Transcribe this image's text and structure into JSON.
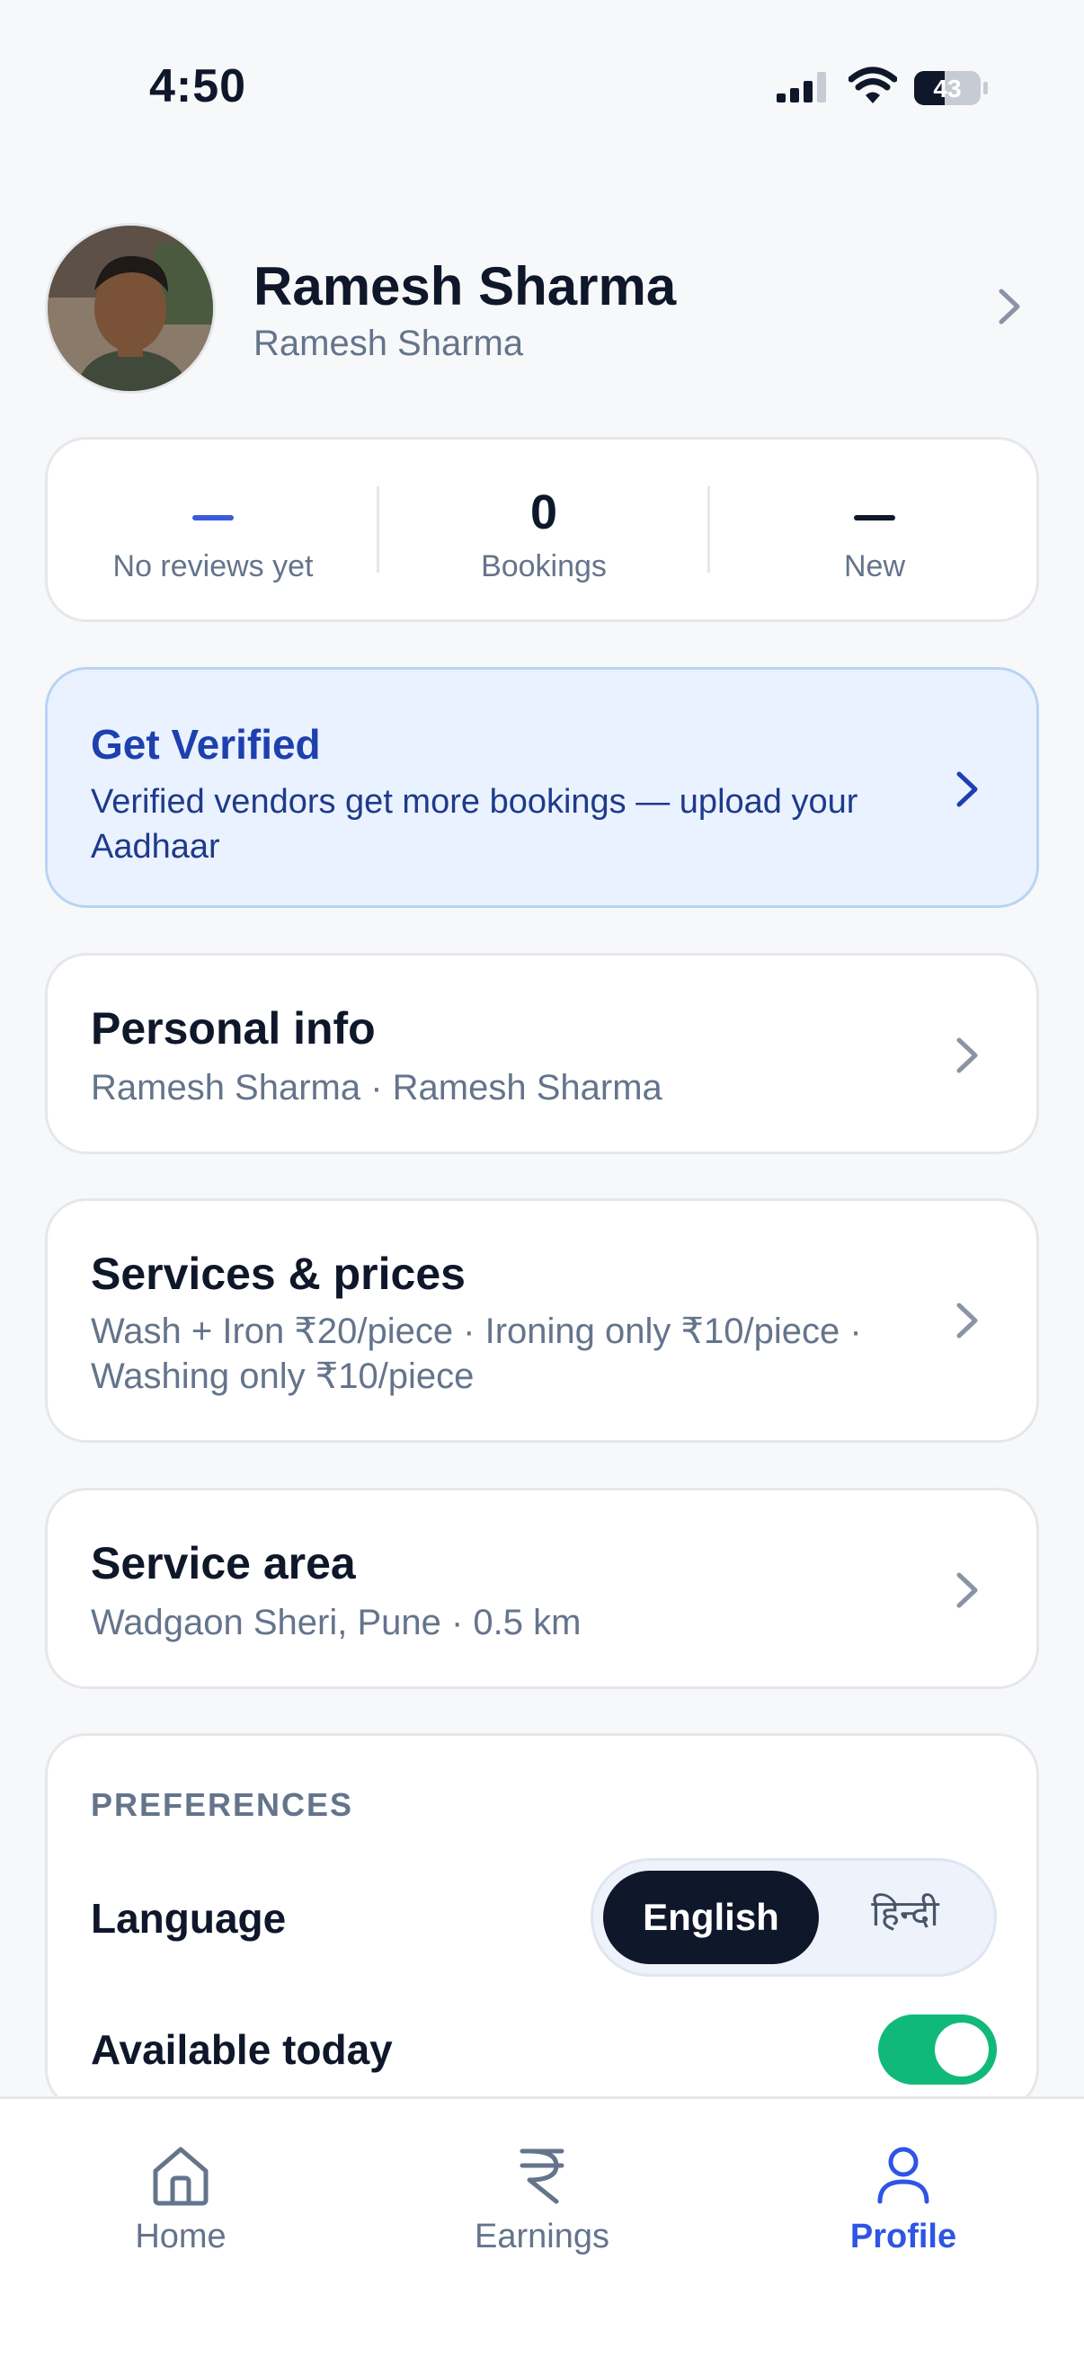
{
  "status_bar": {
    "time": "4:50",
    "battery": "43"
  },
  "profile": {
    "name": "Ramesh Sharma",
    "subtitle": "Ramesh Sharma"
  },
  "stats": [
    {
      "value": "—",
      "label": "No reviews yet",
      "accent": "#3b5bdb"
    },
    {
      "value": "0",
      "label": "Bookings"
    },
    {
      "value": "—",
      "label": "New",
      "accent": "#0f172a"
    }
  ],
  "verify": {
    "title": "Get Verified",
    "description": "Verified vendors get more bookings — upload your Aadhaar"
  },
  "personal_info": {
    "title": "Personal info",
    "subtitle": "Ramesh Sharma · Ramesh Sharma"
  },
  "services": {
    "title": "Services & prices",
    "subtitle": "Wash + Iron ₹20/piece · Ironing only ₹10/piece · Washing only ₹10/piece"
  },
  "service_area": {
    "title": "Service area",
    "subtitle": "Wadgaon Sheri, Pune · 0.5 km"
  },
  "preferences": {
    "heading": "PREFERENCES",
    "language_label": "Language",
    "language_options": [
      "English",
      "हिन्दी"
    ],
    "language_selected": "English",
    "available_label": "Available today",
    "available_on": true
  },
  "nav": [
    {
      "label": "Home",
      "icon": "home-icon"
    },
    {
      "label": "Earnings",
      "icon": "rupee-icon"
    },
    {
      "label": "Profile",
      "icon": "profile-icon",
      "active": true
    }
  ],
  "colors": {
    "accent": "#2f55e4",
    "verify_bg": "#eaf2ff",
    "toggle_on": "#10b97a",
    "dark": "#0f172a"
  }
}
